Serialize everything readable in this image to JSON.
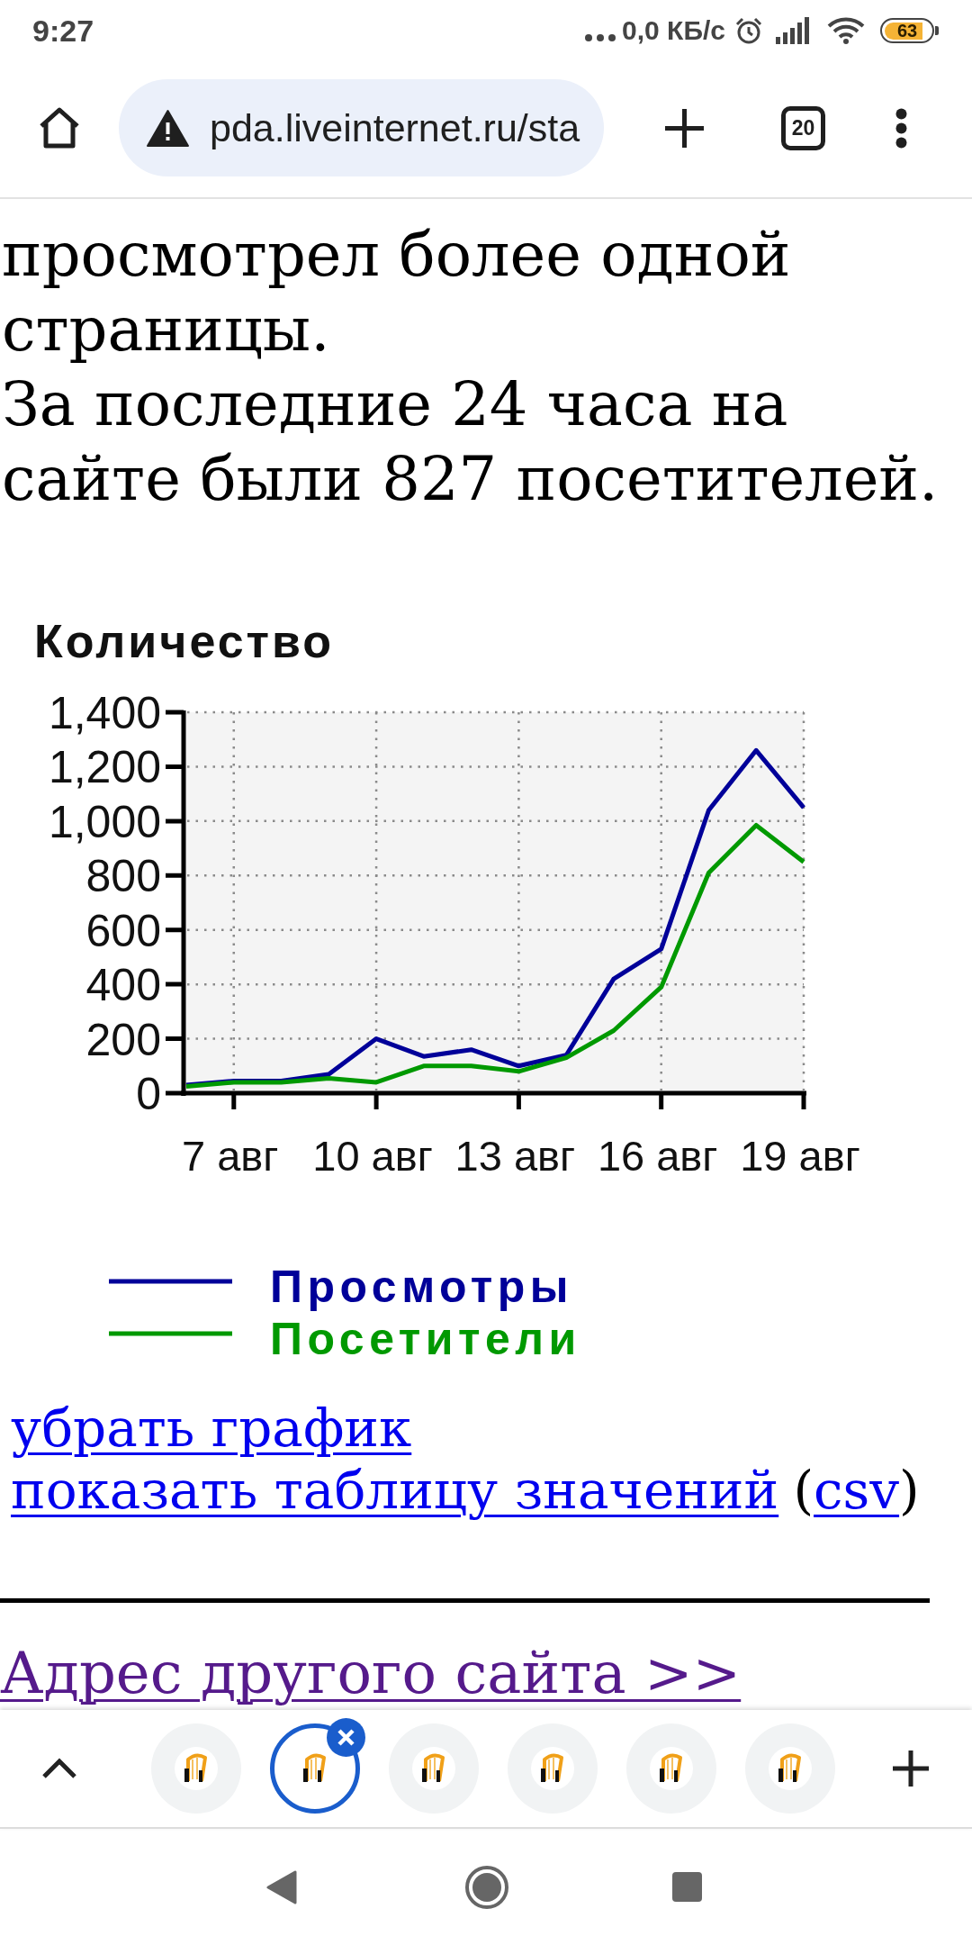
{
  "status_bar": {
    "time": "9:27",
    "network_speed": "0,0 КБ/с",
    "battery": "63"
  },
  "toolbar": {
    "url": "pda.liveinternet.ru/sta",
    "tab_count": "20"
  },
  "content": {
    "paragraphs": [
      "просмотрел более одной страницы.",
      "За последние 24 часа на сайте были 827 посетителей."
    ],
    "chart_data": {
      "type": "line",
      "ylabel": "Количество",
      "x": [
        6,
        7,
        8,
        9,
        10,
        11,
        12,
        13,
        14,
        15,
        16,
        17,
        18,
        19
      ],
      "series": [
        {
          "name": "Просмотры",
          "color": "#000099",
          "values": [
            30,
            45,
            45,
            70,
            200,
            135,
            160,
            100,
            140,
            420,
            530,
            1040,
            1260,
            1050
          ]
        },
        {
          "name": "Посетители",
          "color": "#009900",
          "values": [
            25,
            40,
            40,
            55,
            40,
            100,
            100,
            80,
            130,
            230,
            390,
            810,
            985,
            850
          ]
        }
      ],
      "xlim": [
        6,
        19
      ],
      "ylim": [
        0,
        1400
      ],
      "xticks": [
        {
          "value": 7,
          "label": "7 авг"
        },
        {
          "value": 10,
          "label": "10 авг"
        },
        {
          "value": 13,
          "label": "13 авг"
        },
        {
          "value": 16,
          "label": "16 авг"
        },
        {
          "value": 19,
          "label": "19 авг"
        }
      ],
      "yticks": [
        0,
        200,
        400,
        600,
        800,
        {
          "value": 1000,
          "label": "1,000"
        },
        {
          "value": 1200,
          "label": "1,200"
        },
        {
          "value": 1400,
          "label": "1,400"
        }
      ],
      "grid": true,
      "legend": "bottom"
    },
    "links": [
      [
        {
          "kind": "link",
          "text": "убрать график",
          "visited": false
        }
      ],
      [
        {
          "kind": "link",
          "text": "показать таблицу значений",
          "visited": false
        },
        {
          "kind": "text",
          "text": "(",
          "space_before": true
        },
        {
          "kind": "link",
          "text": "csv",
          "visited": false
        },
        {
          "kind": "text",
          "text": ")",
          "space_before": false
        }
      ]
    ],
    "other_site_link": {
      "text": "Адрес другого сайта >>",
      "visited": true
    }
  },
  "tab_strip": {
    "tabs": [
      {
        "selected": false
      },
      {
        "selected": true
      },
      {
        "selected": false
      },
      {
        "selected": false
      },
      {
        "selected": false
      },
      {
        "selected": false
      }
    ]
  }
}
